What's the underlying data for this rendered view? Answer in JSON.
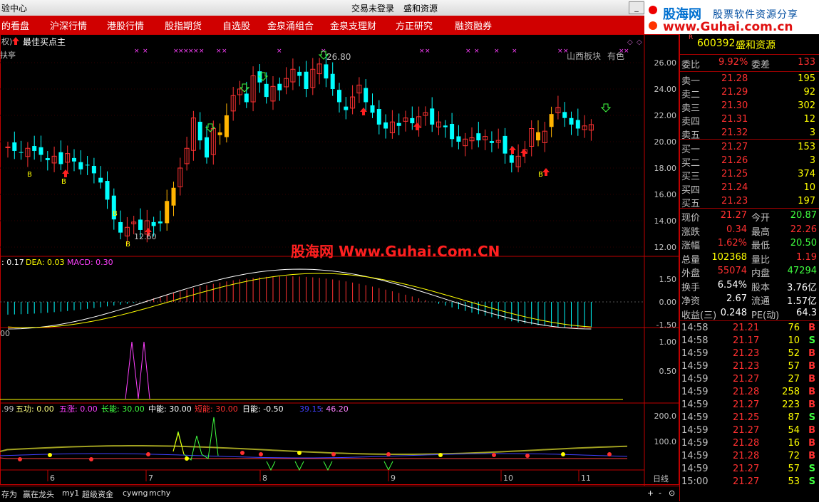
{
  "titlebar": {
    "left_title": "验中心",
    "center_title": "交易未登录",
    "stock_title": "盛和资源",
    "min": "_",
    "max": "□",
    "close": "×"
  },
  "menu": [
    "的看盘",
    "沪深行情",
    "港股行情",
    "股指期货",
    "自选股",
    "金泉涌组合",
    "金泉支理财",
    "方正研究",
    "融资融券"
  ],
  "logo": {
    "brand": "股海网",
    "slogan": "股票软件资源分享",
    "url": "www.Guhai.com.cn"
  },
  "chart": {
    "indicator_tag": "权)",
    "formula_name": "最佳买点主",
    "period_label": "扶亭",
    "sector_label": "山西板块",
    "extra_label": "有色",
    "high_label": "26.80",
    "low_label": "12.60",
    "watermark": "股海网 Www.Guhai.Com.CN",
    "price_axis": [
      "26.00",
      "24.00",
      "22.00",
      "20.00",
      "18.00",
      "16.00",
      "14.00",
      "12.00"
    ],
    "macd_header": {
      "dif": ": 0.17",
      "dea": "DEA: 0.03",
      "macd": "MACD: 0.30"
    },
    "macd_axis": [
      "1.50",
      "0.00",
      "-1.50"
    ],
    "sub1_value": "00",
    "sub1_axis": [
      "1.00",
      "0.50"
    ],
    "sub2_header": {
      "v0": ".99",
      "wugong": "五功: 0.00",
      "wuzhang": "五涨: 0.00",
      "changneng": "长能: 30.00",
      "zhongneng": "中能: 30.00",
      "duanneng": "短能: 30.00",
      "rineng": "日能: -0.50",
      "v1": "39.15",
      "v2": ": 46.20"
    },
    "sub2_axis": [
      "200.0",
      "100.0"
    ],
    "months": [
      "6",
      "7",
      "8",
      "9",
      "10",
      "11"
    ],
    "period": "日线",
    "colors": {
      "up": "#ff3232",
      "down": "#00ffff",
      "gold": "#ffb400",
      "macd_up": "#ff3232",
      "macd_down": "#00ffff"
    }
  },
  "quote": {
    "code": "600392",
    "name": "盛和资源",
    "r_mark": "R",
    "weibi_label": "委比",
    "weibi": "9.92%",
    "weicha_label": "委差",
    "weicha": "133",
    "asks": [
      {
        "label": "卖五",
        "price": "21.32",
        "vol": "3"
      },
      {
        "label": "卖四",
        "price": "21.31",
        "vol": "12"
      },
      {
        "label": "卖三",
        "price": "21.30",
        "vol": "302"
      },
      {
        "label": "卖二",
        "price": "21.29",
        "vol": "92"
      },
      {
        "label": "卖一",
        "price": "21.28",
        "vol": "195"
      }
    ],
    "bids": [
      {
        "label": "买一",
        "price": "21.27",
        "vol": "153"
      },
      {
        "label": "买二",
        "price": "21.26",
        "vol": "3"
      },
      {
        "label": "买三",
        "price": "21.25",
        "vol": "374"
      },
      {
        "label": "买四",
        "price": "21.24",
        "vol": "10"
      },
      {
        "label": "买五",
        "price": "21.23",
        "vol": "197"
      }
    ],
    "stats": [
      {
        "l1": "现价",
        "v1": "21.27",
        "l2": "今开",
        "v2": "20.87"
      },
      {
        "l1": "涨跌",
        "v1": "0.34",
        "l2": "最高",
        "v2": "22.26"
      },
      {
        "l1": "涨幅",
        "v1": "1.62%",
        "l2": "最低",
        "v2": "20.50"
      },
      {
        "l1": "总量",
        "v1": "102368",
        "l2": "量比",
        "v2": "1.19"
      },
      {
        "l1": "外盘",
        "v1": "55074",
        "l2": "内盘",
        "v2": "47294"
      },
      {
        "l1": "换手",
        "v1": "6.54%",
        "l2": "股本",
        "v2": "3.76亿"
      },
      {
        "l1": "净资",
        "v1": "2.67",
        "l2": "流通",
        "v2": "1.57亿"
      },
      {
        "l1": "收益(三)",
        "v1": "0.248",
        "l2": "PE(动)",
        "v2": "64.3"
      }
    ],
    "ticks": [
      {
        "t": "14:58",
        "p": "21.21",
        "v": "76",
        "s": "B"
      },
      {
        "t": "14:58",
        "p": "21.17",
        "v": "10",
        "s": "S"
      },
      {
        "t": "14:59",
        "p": "21.23",
        "v": "52",
        "s": "B"
      },
      {
        "t": "14:59",
        "p": "21.23",
        "v": "57",
        "s": "B"
      },
      {
        "t": "14:59",
        "p": "21.27",
        "v": "27",
        "s": "B"
      },
      {
        "t": "14:59",
        "p": "21.28",
        "v": "258",
        "s": "B"
      },
      {
        "t": "14:59",
        "p": "21.27",
        "v": "223",
        "s": "B"
      },
      {
        "t": "14:59",
        "p": "21.25",
        "v": "87",
        "s": "S"
      },
      {
        "t": "14:59",
        "p": "21.27",
        "v": "54",
        "s": "B"
      },
      {
        "t": "14:59",
        "p": "21.28",
        "v": "16",
        "s": "B"
      },
      {
        "t": "14:59",
        "p": "21.28",
        "v": "72",
        "s": "B"
      },
      {
        "t": "14:59",
        "p": "21.27",
        "v": "57",
        "s": "S"
      },
      {
        "t": "15:00",
        "p": "21.27",
        "v": "53",
        "s": "S"
      }
    ]
  },
  "bottom_tabs": [
    "存为",
    "赢在龙头",
    "my1",
    "超级资金",
    "cywng",
    "mchy"
  ],
  "bottom_controls": [
    "+",
    "-",
    "⊙"
  ]
}
